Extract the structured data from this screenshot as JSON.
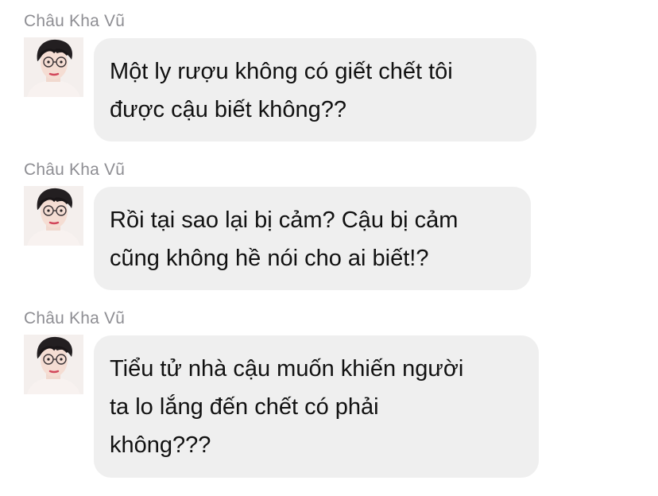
{
  "chat": {
    "messages": [
      {
        "sender": "Châu Kha Vũ",
        "avatar_icon": "user-avatar-photo",
        "text": "Một ly rượu không có giết chết tôi\nđược cậu biết không??"
      },
      {
        "sender": "Châu Kha Vũ",
        "avatar_icon": "user-avatar-photo",
        "text": "Rồi tại sao lại bị cảm? Cậu bị cảm\ncũng không hề nói cho ai biết!?"
      },
      {
        "sender": "Châu Kha Vũ",
        "avatar_icon": "user-avatar-photo",
        "text": "Tiểu tử nhà cậu muốn khiến người\nta lo lắng đến chết có phải\nkhông???"
      }
    ]
  },
  "colors": {
    "background": "#ffffff",
    "bubble": "#efefef",
    "sender_name": "#8e8e93",
    "message_text": "#111111"
  }
}
